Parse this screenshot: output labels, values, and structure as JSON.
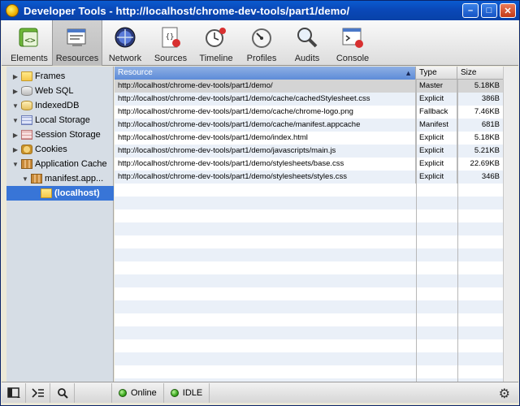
{
  "window": {
    "title": "Developer Tools - http://localhost/chrome-dev-tools/part1/demo/"
  },
  "toolbar": {
    "tabs": [
      {
        "label": "Elements",
        "icon": "elements-icon"
      },
      {
        "label": "Resources",
        "icon": "resources-icon",
        "active": true
      },
      {
        "label": "Network",
        "icon": "network-icon"
      },
      {
        "label": "Sources",
        "icon": "sources-icon"
      },
      {
        "label": "Timeline",
        "icon": "timeline-icon"
      },
      {
        "label": "Profiles",
        "icon": "profiles-icon"
      },
      {
        "label": "Audits",
        "icon": "audits-icon"
      },
      {
        "label": "Console",
        "icon": "console-icon"
      }
    ]
  },
  "sidebar": {
    "items": [
      {
        "label": "Frames",
        "expanded": false,
        "icon": "folder-icon"
      },
      {
        "label": "Web SQL",
        "expanded": false,
        "icon": "database-icon"
      },
      {
        "label": "IndexedDB",
        "expanded": true,
        "icon": "database-icon"
      },
      {
        "label": "Local Storage",
        "expanded": true,
        "icon": "storage-grid-icon"
      },
      {
        "label": "Session Storage",
        "expanded": false,
        "icon": "storage-grid-icon"
      },
      {
        "label": "Cookies",
        "expanded": false,
        "icon": "cookie-icon"
      },
      {
        "label": "Application Cache",
        "expanded": true,
        "icon": "appcache-icon"
      },
      {
        "label": "manifest.app...",
        "expanded": true,
        "icon": "appcache-icon"
      },
      {
        "label": "(localhost)",
        "selected": true,
        "icon": "folder-icon"
      }
    ]
  },
  "grid": {
    "columns": [
      "Resource",
      "Type",
      "Size"
    ],
    "sorted_column": "Resource",
    "rows": [
      {
        "resource": "http://localhost/chrome-dev-tools/part1/demo/",
        "type": "Master",
        "size": "5.18KB"
      },
      {
        "resource": "http://localhost/chrome-dev-tools/part1/demo/cache/cachedStylesheet.css",
        "type": "Explicit",
        "size": "386B"
      },
      {
        "resource": "http://localhost/chrome-dev-tools/part1/demo/cache/chrome-logo.png",
        "type": "Fallback",
        "size": "7.46KB"
      },
      {
        "resource": "http://localhost/chrome-dev-tools/part1/demo/cache/manifest.appcache",
        "type": "Manifest",
        "size": "681B"
      },
      {
        "resource": "http://localhost/chrome-dev-tools/part1/demo/index.html",
        "type": "Explicit",
        "size": "5.18KB"
      },
      {
        "resource": "http://localhost/chrome-dev-tools/part1/demo/javascripts/main.js",
        "type": "Explicit",
        "size": "5.21KB"
      },
      {
        "resource": "http://localhost/chrome-dev-tools/part1/demo/stylesheets/base.css",
        "type": "Explicit",
        "size": "22.69KB"
      },
      {
        "resource": "http://localhost/chrome-dev-tools/part1/demo/stylesheets/styles.css",
        "type": "Explicit",
        "size": "346B"
      }
    ]
  },
  "statusbar": {
    "online_label": "Online",
    "idle_label": "IDLE"
  },
  "colors": {
    "selection": "#3875d7",
    "titlebar": "#0a48b8",
    "status_ok": "#3aa81e"
  }
}
